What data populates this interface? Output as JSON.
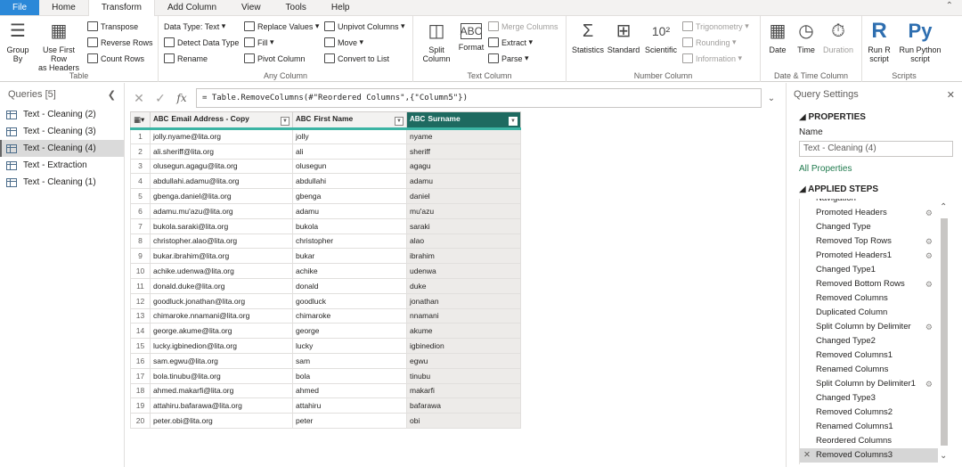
{
  "menu": {
    "tabs": [
      "File",
      "Home",
      "Transform",
      "Add Column",
      "View",
      "Tools",
      "Help"
    ],
    "active": "Transform"
  },
  "ribbon": {
    "table": {
      "title": "Table",
      "group_by": "Group\nBy",
      "use_first_row": "Use First Row\nas Headers",
      "transpose": "Transpose",
      "reverse_rows": "Reverse Rows",
      "count_rows": "Count Rows"
    },
    "any_column": {
      "title": "Any Column",
      "data_type": "Data Type: Text",
      "detect_data_type": "Detect Data Type",
      "rename": "Rename",
      "replace_values": "Replace Values",
      "fill": "Fill",
      "pivot_column": "Pivot Column",
      "unpivot_columns": "Unpivot Columns",
      "move": "Move",
      "convert_to_list": "Convert to List"
    },
    "text_column": {
      "title": "Text Column",
      "split_column": "Split\nColumn",
      "format": "Format",
      "merge_columns": "Merge Columns",
      "extract": "Extract",
      "parse": "Parse"
    },
    "number_column": {
      "title": "Number Column",
      "statistics": "Statistics",
      "standard": "Standard",
      "scientific": "Scientific",
      "trigonometry": "Trigonometry",
      "rounding": "Rounding",
      "information": "Information"
    },
    "datetime": {
      "title": "Date & Time Column",
      "date": "Date",
      "time": "Time",
      "duration": "Duration"
    },
    "scripts": {
      "title": "Scripts",
      "run_r": "Run R\nscript",
      "run_python": "Run Python\nscript"
    }
  },
  "queries": {
    "header": "Queries [5]",
    "items": [
      "Text - Cleaning (2)",
      "Text - Cleaning (3)",
      "Text - Cleaning (4)",
      "Text - Extraction",
      "Text - Cleaning (1)"
    ],
    "selected_index": 2
  },
  "formula": {
    "text": "= Table.RemoveColumns(#\"Reordered Columns\",{\"Column5\"})",
    "fx": "fx"
  },
  "table": {
    "columns": [
      "Email Address - Copy",
      "First Name",
      "Surname"
    ],
    "type_badge": "ABC",
    "rows": [
      [
        "jolly.nyame@lita.org",
        "jolly",
        "nyame"
      ],
      [
        "ali.sheriff@lita.org",
        "ali",
        "sheriff"
      ],
      [
        "olusegun.agagu@lita.org",
        "olusegun",
        "agagu"
      ],
      [
        "abdullahi.adamu@lita.org",
        "abdullahi",
        "adamu"
      ],
      [
        "gbenga.daniel@lita.org",
        "gbenga",
        "daniel"
      ],
      [
        "adamu.mu'azu@lita.org",
        "adamu",
        "mu'azu"
      ],
      [
        "bukola.saraki@lita.org",
        "bukola",
        "saraki"
      ],
      [
        "christopher.alao@lita.org",
        "christopher",
        "alao"
      ],
      [
        "bukar.ibrahim@lita.org",
        "bukar",
        "ibrahim"
      ],
      [
        "achike.udenwa@lita.org",
        "achike",
        "udenwa"
      ],
      [
        "donald.duke@lita.org",
        "donald",
        "duke"
      ],
      [
        "goodluck.jonathan@lita.org",
        "goodluck",
        "jonathan"
      ],
      [
        "chimaroke.nnamani@lita.org",
        "chimaroke",
        "nnamani"
      ],
      [
        "george.akume@lita.org",
        "george",
        "akume"
      ],
      [
        "lucky.igbinedion@lita.org",
        "lucky",
        "igbinedion"
      ],
      [
        "sam.egwu@lita.org",
        "sam",
        "egwu"
      ],
      [
        "bola.tinubu@lita.org",
        "bola",
        "tinubu"
      ],
      [
        "ahmed.makarfi@lita.org",
        "ahmed",
        "makarfi"
      ],
      [
        "attahiru.bafarawa@lita.org",
        "attahiru",
        "bafarawa"
      ],
      [
        "peter.obi@lita.org",
        "peter",
        "obi"
      ]
    ]
  },
  "settings": {
    "title": "Query Settings",
    "properties": "PROPERTIES",
    "name_label": "Name",
    "name_value": "Text - Cleaning (4)",
    "all_properties": "All Properties",
    "applied_steps": "APPLIED STEPS",
    "steps": [
      {
        "label": "Navigation",
        "gear": false
      },
      {
        "label": "Promoted Headers",
        "gear": true
      },
      {
        "label": "Changed Type",
        "gear": false
      },
      {
        "label": "Removed Top Rows",
        "gear": true
      },
      {
        "label": "Promoted Headers1",
        "gear": true
      },
      {
        "label": "Changed Type1",
        "gear": false
      },
      {
        "label": "Removed Bottom Rows",
        "gear": true
      },
      {
        "label": "Removed Columns",
        "gear": false
      },
      {
        "label": "Duplicated Column",
        "gear": false
      },
      {
        "label": "Split Column by Delimiter",
        "gear": true
      },
      {
        "label": "Changed Type2",
        "gear": false
      },
      {
        "label": "Removed Columns1",
        "gear": false
      },
      {
        "label": "Renamed Columns",
        "gear": false
      },
      {
        "label": "Split Column by Delimiter1",
        "gear": true
      },
      {
        "label": "Changed Type3",
        "gear": false
      },
      {
        "label": "Removed Columns2",
        "gear": false
      },
      {
        "label": "Renamed Columns1",
        "gear": false
      },
      {
        "label": "Reordered Columns",
        "gear": false
      },
      {
        "label": "Removed Columns3",
        "gear": false
      }
    ],
    "active_step_index": 18
  }
}
